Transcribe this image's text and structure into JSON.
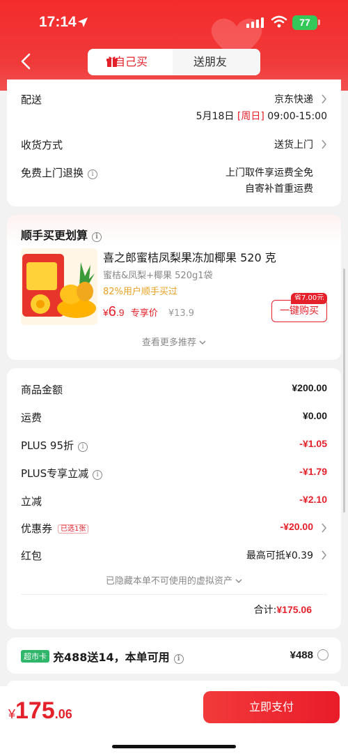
{
  "status": {
    "time": "17:14",
    "battery": "77"
  },
  "nav": {
    "tab_self": "自己买",
    "tab_gift": "送朋友"
  },
  "delivery": {
    "label": "配送",
    "carrier": "京东快递",
    "date": "5月18日",
    "weekday": "[周日]",
    "time_window": "09:00-15:00",
    "receive_label": "收货方式",
    "receive_value": "送货上门",
    "return_label": "免费上门退换",
    "return_line1": "上门取件享运费全免",
    "return_line2": "自寄补首重运费"
  },
  "addon": {
    "title": "顺手买更划算",
    "product_name": "喜之郎蜜桔凤梨果冻加椰果 520 克",
    "spec": "蜜桔&凤梨+椰果 520g1袋",
    "bought_rate": "82%用户顺手买过",
    "price_symbol": "¥",
    "price_int": "6",
    "price_dec": ".9",
    "price_tag": "专享价",
    "original_price": "¥13.9",
    "save_badge": "省7.00元",
    "buy_button": "一键购买",
    "more": "查看更多推荐"
  },
  "summary": {
    "rows": [
      {
        "label": "商品金额",
        "value": "¥200.00",
        "red": false,
        "info": false,
        "chevron": false
      },
      {
        "label": "运费",
        "value": "¥0.00",
        "red": false,
        "info": false,
        "chevron": false
      },
      {
        "label": "PLUS 95折",
        "value": "-¥1.05",
        "red": true,
        "info": true,
        "chevron": false
      },
      {
        "label": "PLUS专享立减",
        "value": "-¥1.79",
        "red": true,
        "info": true,
        "chevron": false
      },
      {
        "label": "立减",
        "value": "-¥2.10",
        "red": true,
        "info": false,
        "chevron": false
      },
      {
        "label": "优惠券",
        "value": "-¥20.00",
        "red": true,
        "info": false,
        "chevron": true,
        "badge": "已选1张"
      },
      {
        "label": "红包",
        "value": "最高可抵¥0.39",
        "red": false,
        "info": false,
        "chevron": true
      }
    ],
    "hidden_assets": "已隐藏本单不可使用的虚拟资产",
    "total_label": "合计:",
    "total_value": "¥175.06"
  },
  "membership": {
    "badge": "超市卡",
    "text": "充488送14，本单可用",
    "price": "¥488"
  },
  "footer": {
    "symbol": "¥",
    "amount_int": "175",
    "amount_dec": ".06",
    "pay_button": "立即支付"
  },
  "colors": {
    "brand_red": "#e4202a",
    "orange": "#e8a020",
    "green": "#2fb66a"
  }
}
